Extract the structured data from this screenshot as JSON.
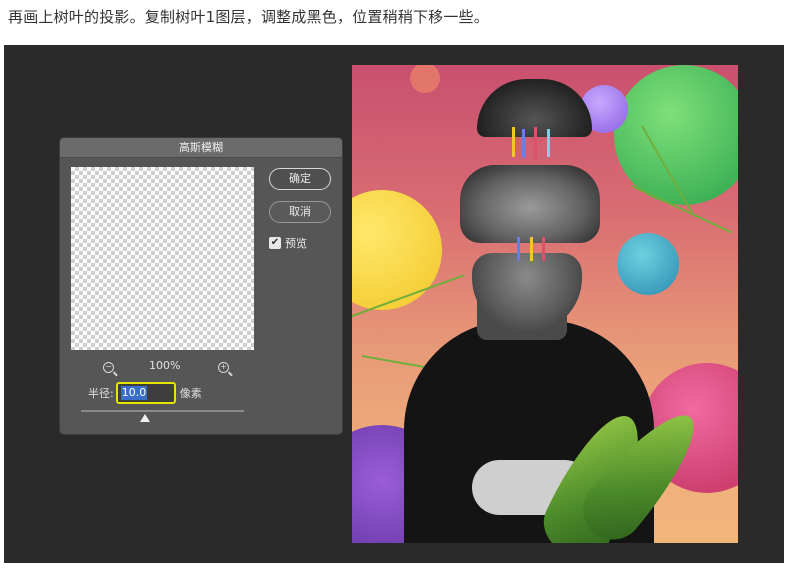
{
  "caption": "再画上树叶的投影。复制树叶1图层，调整成黑色，位置稍稍下移一些。",
  "dialog": {
    "title": "高斯模糊",
    "ok_label": "确定",
    "cancel_label": "取消",
    "preview_label": "预览",
    "preview_checked": true,
    "zoom_level": "100%",
    "radius_label": "半径:",
    "radius_value": "10.0",
    "radius_unit": "像素"
  },
  "colors": {
    "workspace": "#2a2a2a",
    "dialog_bg": "#565656",
    "highlight": "#e4e600",
    "selection": "#3a6fc9"
  },
  "icons": {
    "zoom_out": "zoom-out-icon",
    "zoom_in": "zoom-in-icon",
    "check": "check-icon",
    "slider": "slider-thumb-icon"
  }
}
